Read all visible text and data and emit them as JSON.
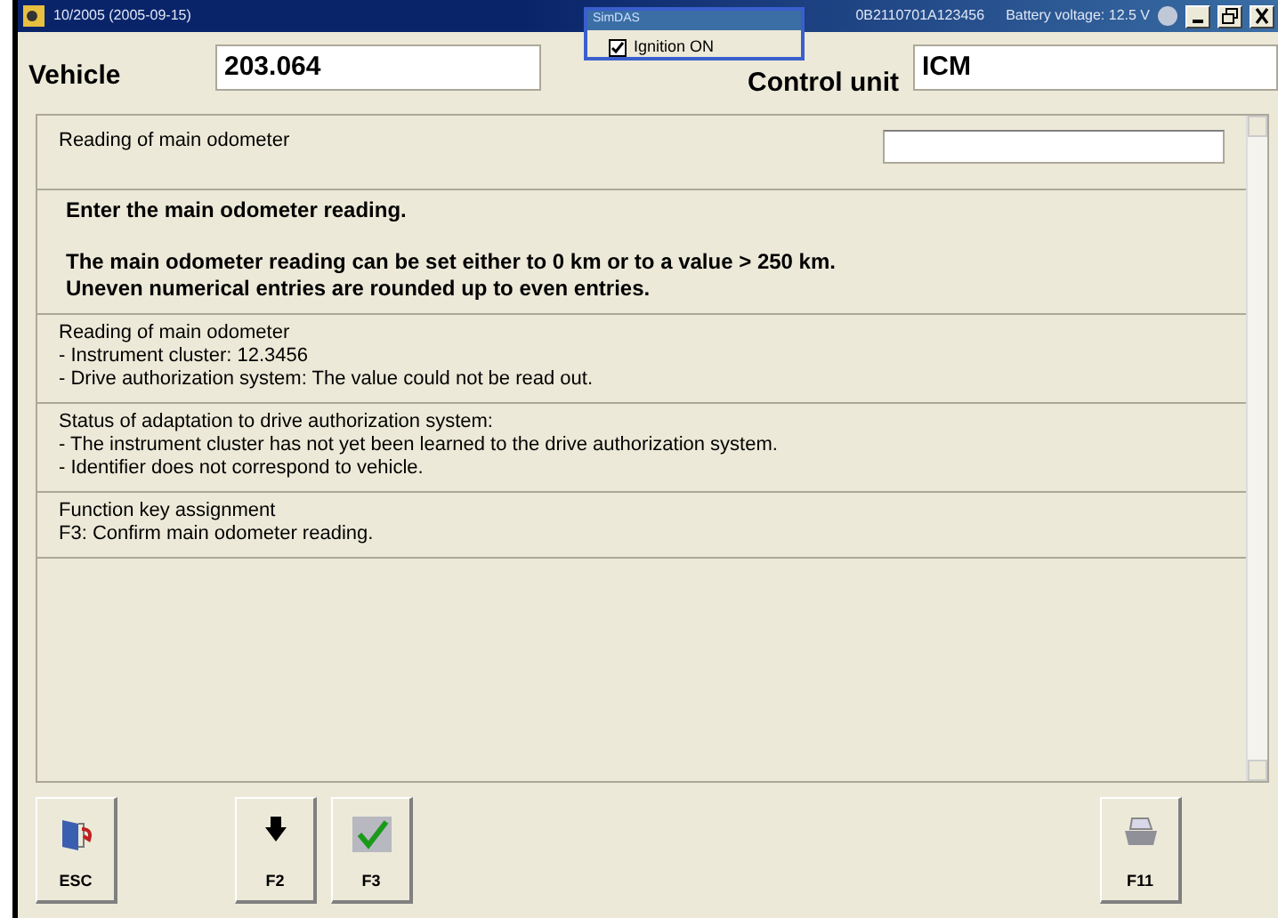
{
  "title_bar": {
    "title": "10/2005 (2005-09-15)",
    "serial": "0B2110701A123456",
    "battery": "Battery voltage: 12.5 V"
  },
  "popup": {
    "title": "SimDAS",
    "checkbox": {
      "label": "Ignition ON",
      "checked": true
    }
  },
  "header": {
    "vehicle_label": "Vehicle",
    "vehicle_value": "203.064",
    "control_unit_label": "Control unit",
    "control_unit_value": "ICM"
  },
  "input_row": {
    "label": "Reading of main odometer"
  },
  "sections": [
    {
      "bold": true,
      "paragraphs": [
        [
          "Enter the main odometer reading."
        ],
        [
          "The main odometer reading can be set either to 0 km or to a value > 250 km.",
          "Uneven numerical entries are rounded up to even entries."
        ]
      ]
    },
    {
      "bold": false,
      "paragraphs": [
        [
          "Reading of main odometer",
          "- Instrument cluster: 12.3456",
          "- Drive authorization system:  The value could not be read out."
        ]
      ]
    },
    {
      "bold": false,
      "paragraphs": [
        [
          "Status of adaptation to drive authorization system:",
          "- The instrument cluster has not yet been learned to the drive authorization system.",
          "- Identifier does not correspond to vehicle."
        ]
      ]
    },
    {
      "bold": false,
      "paragraphs": [
        [
          "Function key assignment",
          "F3: Confirm main odometer reading."
        ]
      ]
    }
  ],
  "button_groups": [
    [
      {
        "label": "ESC",
        "kind": "exit"
      }
    ],
    [
      {
        "label": "F2",
        "kind": "down"
      },
      {
        "label": "F3",
        "kind": "confirm"
      }
    ],
    [
      {
        "label": "F11",
        "kind": "print"
      }
    ]
  ]
}
